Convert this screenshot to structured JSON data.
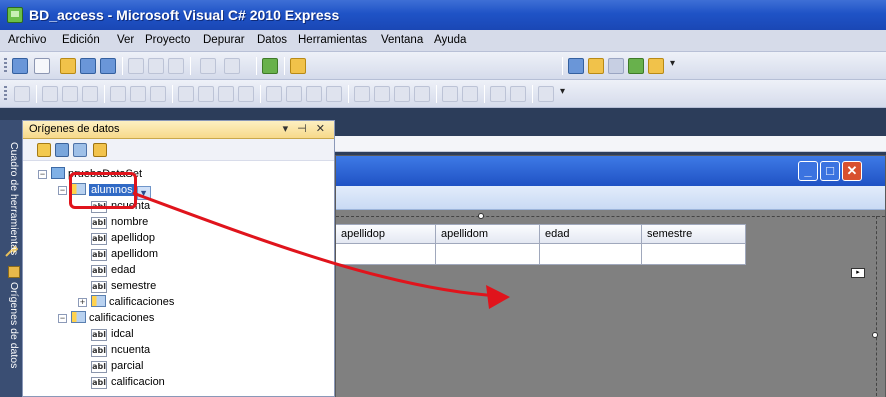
{
  "window": {
    "title": "BD_access - Microsoft Visual C# 2010 Express"
  },
  "menu": [
    "Archivo",
    "Edición",
    "Ver",
    "Proyecto",
    "Depurar",
    "Datos",
    "Herramientas",
    "Ventana",
    "Ayuda"
  ],
  "toolbar": {
    "combo_value": "\""
  },
  "side_tabs": {
    "toolbox": "Cuadro de herramientas",
    "datasources": "Orígenes de datos"
  },
  "datasources": {
    "title": "Orígenes de datos",
    "controls": "▾ ⊣ ✕",
    "dataset": "pruebaDataSet",
    "tables": [
      {
        "name": "alumnos",
        "fields": [
          "ncuenta",
          "nombre",
          "apellidop",
          "apellidom",
          "edad",
          "semestre"
        ],
        "relation": "calificaciones"
      },
      {
        "name": "calificaciones",
        "fields": [
          "idcal",
          "ncuenta",
          "parcial",
          "calificacion"
        ]
      }
    ],
    "field_icon_text": "abl"
  },
  "grid": {
    "columns": [
      "apellidop",
      "apellidom",
      "edad",
      "semestre"
    ]
  },
  "form_buttons": {
    "min": "_",
    "max": "□",
    "close": "✕"
  },
  "colors": {
    "annotation": "#e0141c",
    "selection": "#316ac5",
    "title_bar": "#1f53c6"
  }
}
